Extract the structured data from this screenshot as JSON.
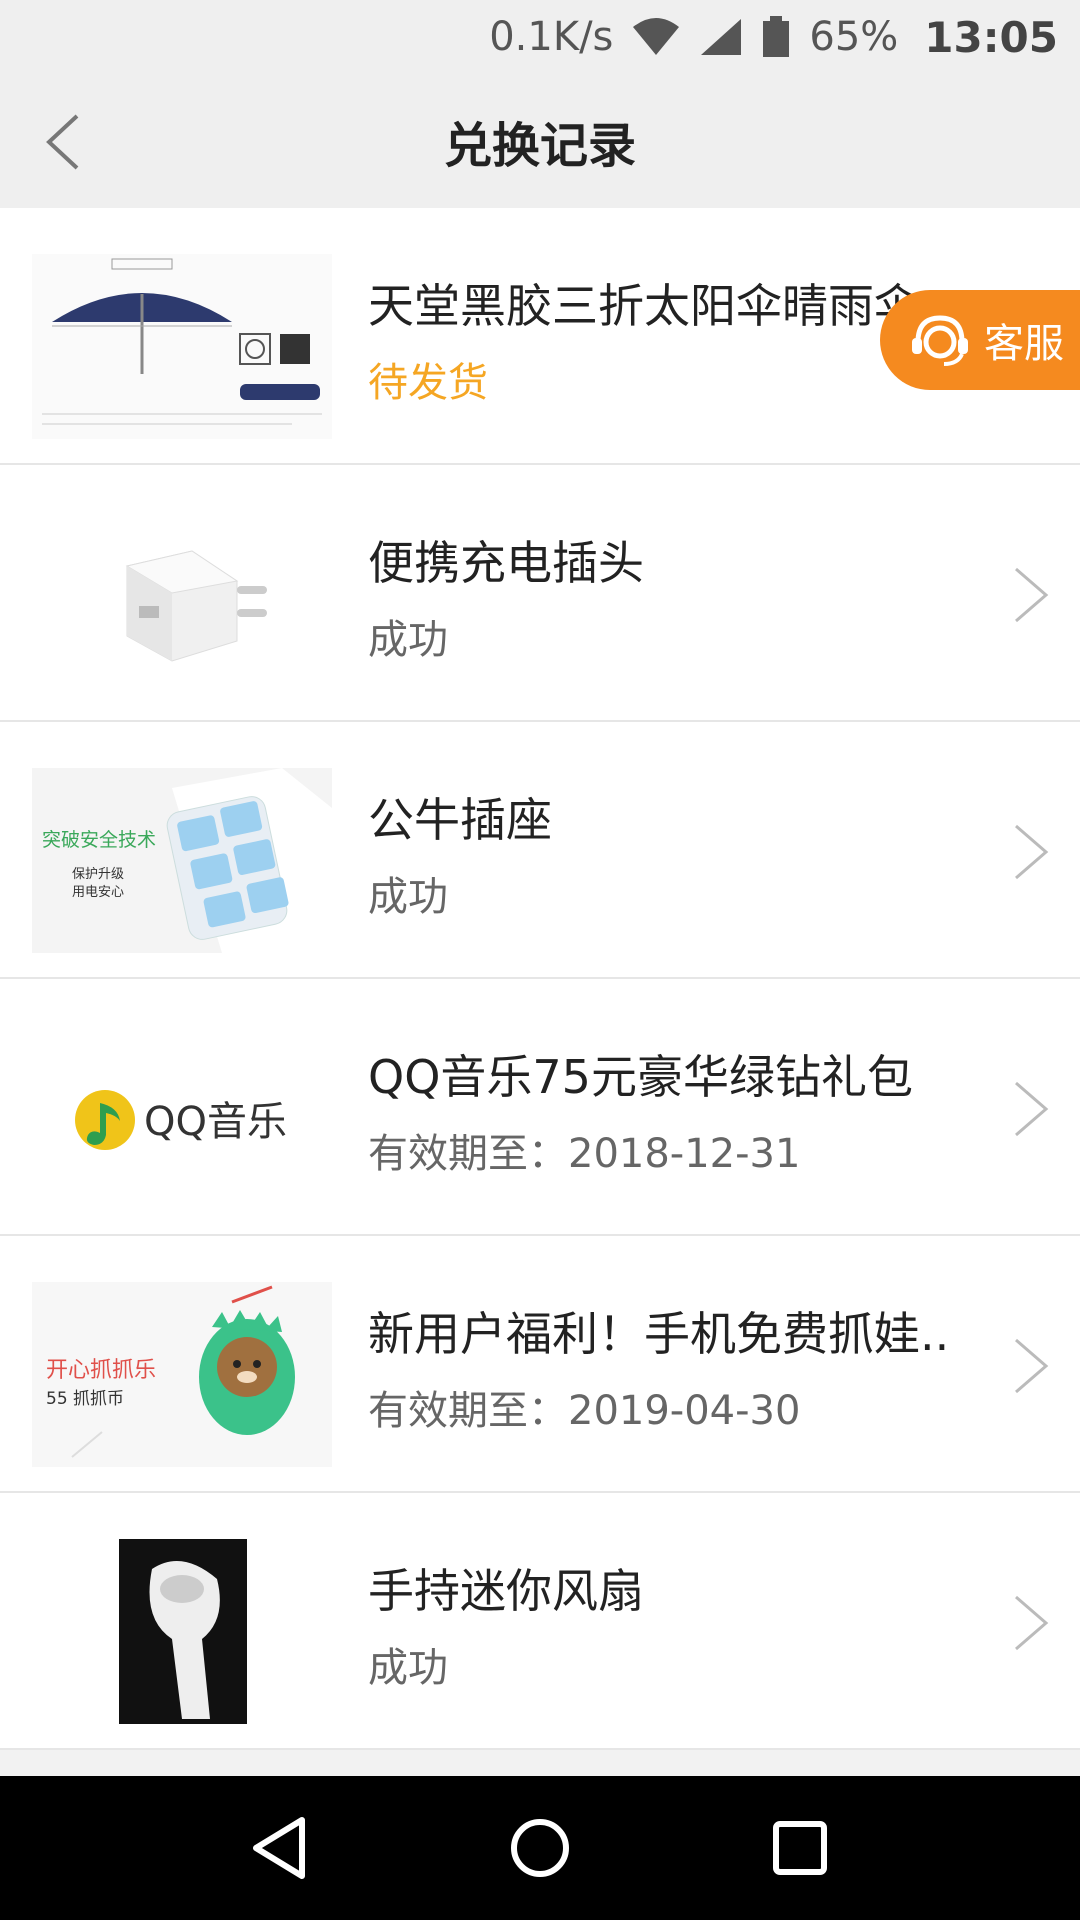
{
  "status_bar": {
    "speed": "0.1K/s",
    "battery": "65%",
    "time": "13:05"
  },
  "header": {
    "title": "兑换记录"
  },
  "service_button": {
    "label": "客服"
  },
  "records": [
    {
      "name": "天堂黑胶三折太阳伞晴雨伞",
      "status": "待发货",
      "thumb": "umbrella"
    },
    {
      "name": "便携充电插头",
      "status": "成功",
      "thumb": "charger"
    },
    {
      "name": "公牛插座",
      "status": "成功",
      "thumb": "power-strip",
      "thumb_text": [
        "突破安全技术",
        "保护升级",
        "用电安心"
      ]
    },
    {
      "name": "QQ音乐75元豪华绿钻礼包",
      "status": "有效期至：2018-12-31",
      "thumb": "qq-music",
      "thumb_text": [
        "QQ音乐"
      ]
    },
    {
      "name": "新用户福利！手机免费抓娃..",
      "status": "有效期至：2019-04-30",
      "thumb": "claw-machine",
      "thumb_text": [
        "开心抓抓乐",
        "55 抓抓币"
      ]
    },
    {
      "name": "手持迷你风扇",
      "status": "成功",
      "thumb": "mini-fan"
    }
  ],
  "colors": {
    "pending": "#f5a623",
    "service": "#f58a1f"
  }
}
